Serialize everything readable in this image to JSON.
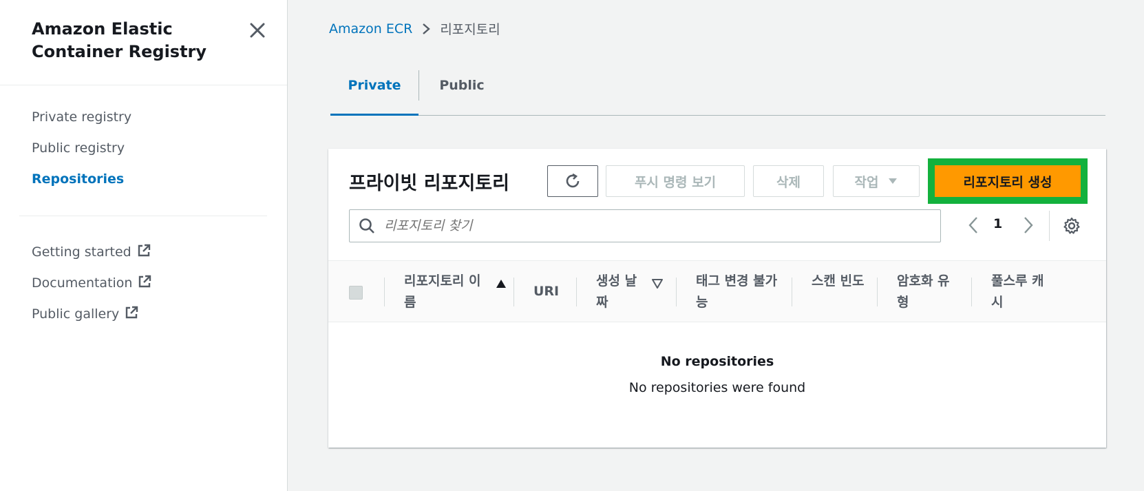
{
  "sidebar": {
    "title": "Amazon Elastic Container Registry",
    "nav": [
      {
        "label": "Private registry"
      },
      {
        "label": "Public registry"
      },
      {
        "label": "Repositories"
      }
    ],
    "links": [
      {
        "label": "Getting started"
      },
      {
        "label": "Documentation"
      },
      {
        "label": "Public gallery"
      }
    ]
  },
  "breadcrumb": {
    "root": "Amazon ECR",
    "current": "리포지토리"
  },
  "tabs": [
    {
      "label": "Private"
    },
    {
      "label": "Public"
    }
  ],
  "panel": {
    "title": "프라이빗 리포지토리",
    "buttons": {
      "push": "푸시 명령 보기",
      "delete": "삭제",
      "actions": "작업",
      "create": "리포지토리 생성"
    },
    "search": {
      "placeholder": "리포지토리 찾기"
    },
    "pagination": {
      "page": "1"
    },
    "columns": [
      {
        "label": "리포지토리 이름"
      },
      {
        "label": "URI"
      },
      {
        "label": "생성 날짜"
      },
      {
        "label": "태그 변경 불가능"
      },
      {
        "label": "스캔 빈도"
      },
      {
        "label": "암호화 유형"
      },
      {
        "label": "풀스루 캐시"
      }
    ],
    "empty": {
      "title": "No repositories",
      "subtitle": "No repositories were found"
    }
  },
  "colors": {
    "accent": "#0073bb",
    "primary_button": "#ff9900",
    "highlight_border": "#13b13d"
  },
  "icons": {
    "close": "close-icon",
    "external": "external-link-icon",
    "refresh": "refresh-icon",
    "search": "search-icon",
    "gear": "gear-icon"
  }
}
